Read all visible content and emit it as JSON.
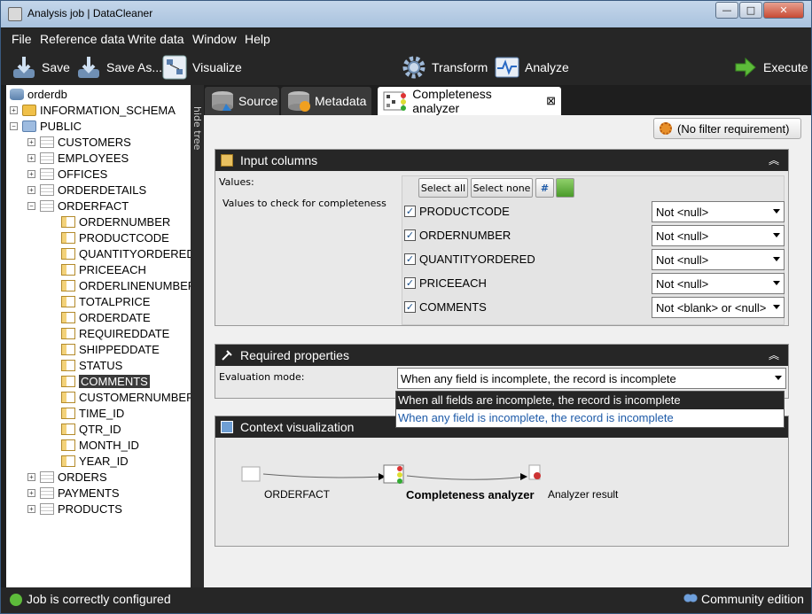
{
  "window": {
    "title": "Analysis job | DataCleaner",
    "min": "—",
    "max": "□",
    "close": "✕"
  },
  "menu": [
    "File",
    "Reference data",
    "Write data",
    "Window",
    "Help"
  ],
  "toolbar": {
    "save": "Save",
    "save_as": "Save As...",
    "visualize": "Visualize",
    "transform": "Transform",
    "analyze": "Analyze",
    "execute": "Execute"
  },
  "tree": {
    "root": "orderdb",
    "schemas": [
      "INFORMATION_SCHEMA",
      "PUBLIC"
    ],
    "tables_before": [
      "CUSTOMERS",
      "EMPLOYEES",
      "OFFICES",
      "ORDERDETAILS",
      "ORDERFACT"
    ],
    "columns": [
      "ORDERNUMBER",
      "PRODUCTCODE",
      "QUANTITYORDERED",
      "PRICEEACH",
      "ORDERLINENUMBER",
      "TOTALPRICE",
      "ORDERDATE",
      "REQUIREDDATE",
      "SHIPPEDDATE",
      "STATUS",
      "COMMENTS",
      "CUSTOMERNUMBER",
      "TIME_ID",
      "QTR_ID",
      "MONTH_ID",
      "YEAR_ID"
    ],
    "selected_column": "COMMENTS",
    "tables_after": [
      "ORDERS",
      "PAYMENTS",
      "PRODUCTS"
    ]
  },
  "hide_tree": "hide tree",
  "tabs": {
    "source": "Source",
    "metadata": "Metadata",
    "completeness": "Completeness analyzer",
    "close": "⊠"
  },
  "filter_button": "(No filter requirement)",
  "input_panel": {
    "title": "Input columns",
    "values_label": "Values:",
    "values_desc": "Values to check for completeness",
    "select_all": "Select all",
    "select_none": "Select none",
    "rows": [
      {
        "name": "PRODUCTCODE",
        "condition": "Not <null>"
      },
      {
        "name": "ORDERNUMBER",
        "condition": "Not <null>"
      },
      {
        "name": "QUANTITYORDERED",
        "condition": "Not <null>"
      },
      {
        "name": "PRICEEACH",
        "condition": "Not <null>"
      },
      {
        "name": "COMMENTS",
        "condition": "Not <blank> or <null>"
      }
    ]
  },
  "required_panel": {
    "title": "Required properties",
    "eval_label": "Evaluation mode:",
    "eval_value": "When any field is incomplete, the record is incomplete",
    "options": [
      "When all fields are incomplete, the record is incomplete",
      "When any field is incomplete, the record is incomplete"
    ]
  },
  "context_panel": {
    "title": "Context visualization",
    "source_node": "ORDERFACT",
    "analyzer_node": "Completeness analyzer",
    "result_node": "Analyzer result"
  },
  "status": {
    "left": "Job is correctly configured",
    "right": "Community edition"
  },
  "colors": {
    "accent": "#1d5aa8",
    "dark": "#262626"
  }
}
